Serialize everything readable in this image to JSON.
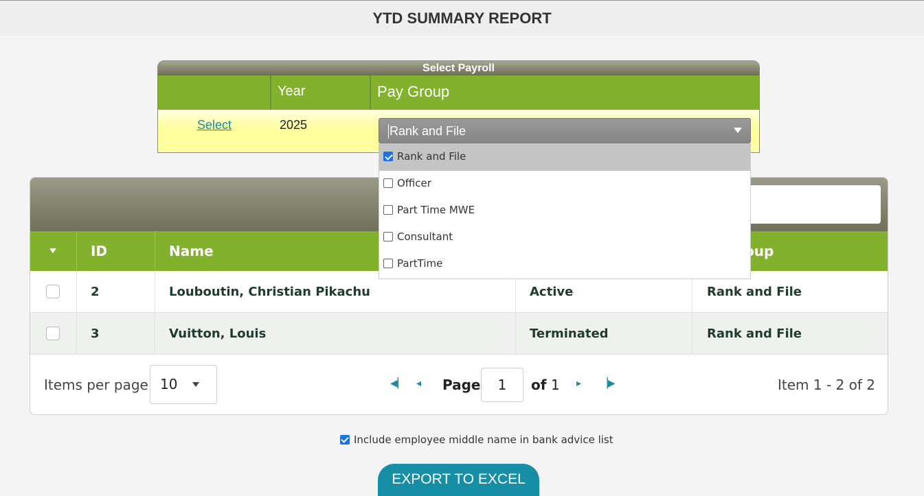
{
  "header": {
    "title": "YTD SUMMARY REPORT"
  },
  "payroll": {
    "caption": "Select Payroll",
    "col_year": "Year",
    "col_group": "Pay Group",
    "select_link": "Select",
    "year": "2025",
    "selected_group": "Rank and File"
  },
  "dropdown": {
    "options": [
      {
        "label": "Rank and File",
        "checked": true
      },
      {
        "label": "Officer",
        "checked": false
      },
      {
        "label": "Part Time MWE",
        "checked": false
      },
      {
        "label": "Consultant",
        "checked": false
      },
      {
        "label": "PartTime",
        "checked": false
      }
    ]
  },
  "grid": {
    "columns": {
      "id": "ID",
      "name": "Name",
      "group": "oup"
    },
    "rows": [
      {
        "id": "2",
        "name": "Louboutin, Christian Pikachu",
        "status": "Active",
        "group": "Rank and File"
      },
      {
        "id": "3",
        "name": "Vuitton, Louis",
        "status": "Terminated",
        "group": "Rank and File"
      }
    ],
    "pager": {
      "items_per_page_label": "Items per page",
      "items_per_page": "10",
      "page_label": "Page",
      "page": "1",
      "of_label": "of",
      "total_pages": "1",
      "info": "Item 1 - 2 of 2"
    }
  },
  "options": {
    "middle_name_label": "Include employee middle name in bank advice list"
  },
  "actions": {
    "export_label": "EXPORT TO EXCEL"
  }
}
